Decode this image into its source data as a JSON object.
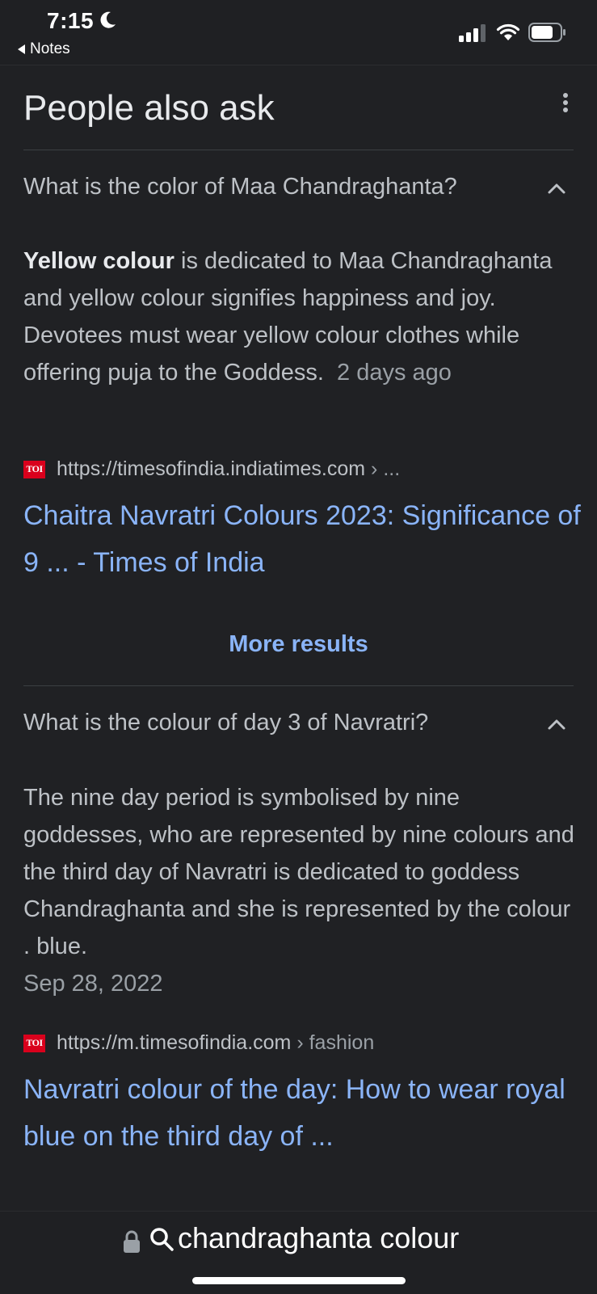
{
  "status_bar": {
    "time": "7:15",
    "back_app": "Notes"
  },
  "section": {
    "title": "People also ask"
  },
  "questions": [
    {
      "question": "What is the color of Maa Chandraghanta?",
      "answer_bold": "Yellow colour",
      "answer_rest": " is dedicated to Maa Chandraghanta and yellow colour signifies happiness and joy. Devotees must wear yellow colour clothes while offering puja to the Goddess.",
      "date": "2 days ago",
      "source_logo": "TOI",
      "source_url": "https://timesofindia.indiatimes.com",
      "source_crumb": " › ...",
      "link_title": "Chaitra Navratri Colours 2023: Significance of 9 ... - Times of India"
    },
    {
      "question": "What is the colour of day 3 of Navratri?",
      "answer_rest": "The nine day period is symbolised by nine goddesses, who are represented by nine colours and the third day of Navratri is dedicated to goddess Chandraghanta and she is represented by the colour . blue.",
      "date": "Sep 28, 2022",
      "source_logo": "TOI",
      "source_url": "https://m.timesofindia.com",
      "source_crumb": " › fashion",
      "link_title": "Navratri colour of the day: How to wear royal blue on the third day of ..."
    }
  ],
  "more_results_label": "More results",
  "address_bar": {
    "query": "chandraghanta colour"
  },
  "icons": {
    "moon": "moon-icon",
    "signal": "signal-icon",
    "wifi": "wifi-icon",
    "battery": "battery-icon",
    "more_options": "more-options-icon",
    "chevron": "chevron-up-icon",
    "lock": "lock-icon",
    "search": "search-icon"
  },
  "colors": {
    "background": "#202124",
    "link": "#8ab4f8",
    "text": "#bdc1c6",
    "toi_red": "#d9001c"
  }
}
